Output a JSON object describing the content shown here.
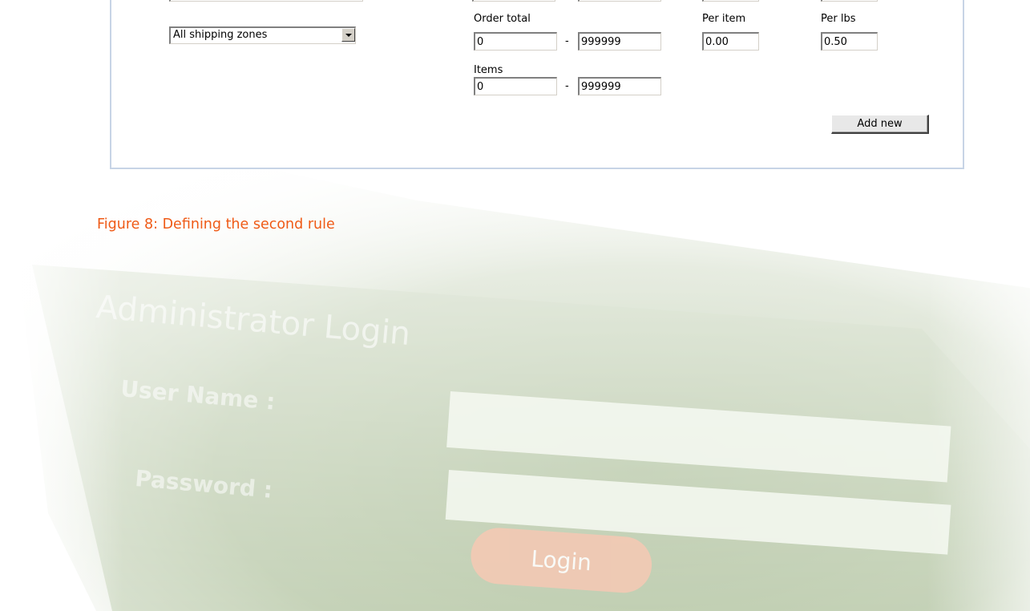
{
  "form": {
    "zone_select": {
      "value": "All shipping zones"
    },
    "order_total": {
      "label": "Order total",
      "min": "0",
      "max": "999999"
    },
    "items": {
      "label": "Items",
      "min": "0",
      "max": "999999"
    },
    "per_item": {
      "label": "Per item",
      "value": "0.00"
    },
    "per_lbs": {
      "label": "Per lbs",
      "value": "0.50"
    },
    "range_separator": "-",
    "add_new_label": "Add new"
  },
  "caption": "Figure 8: Defining the second rule",
  "background": {
    "title": "Administrator Login",
    "user_label": "User Name :",
    "password_label": "Password :",
    "login_label": "Login"
  },
  "colors": {
    "caption": "#ef5a16",
    "panel_border": "#c7d4e6",
    "background_green": "#c6d4b6"
  }
}
